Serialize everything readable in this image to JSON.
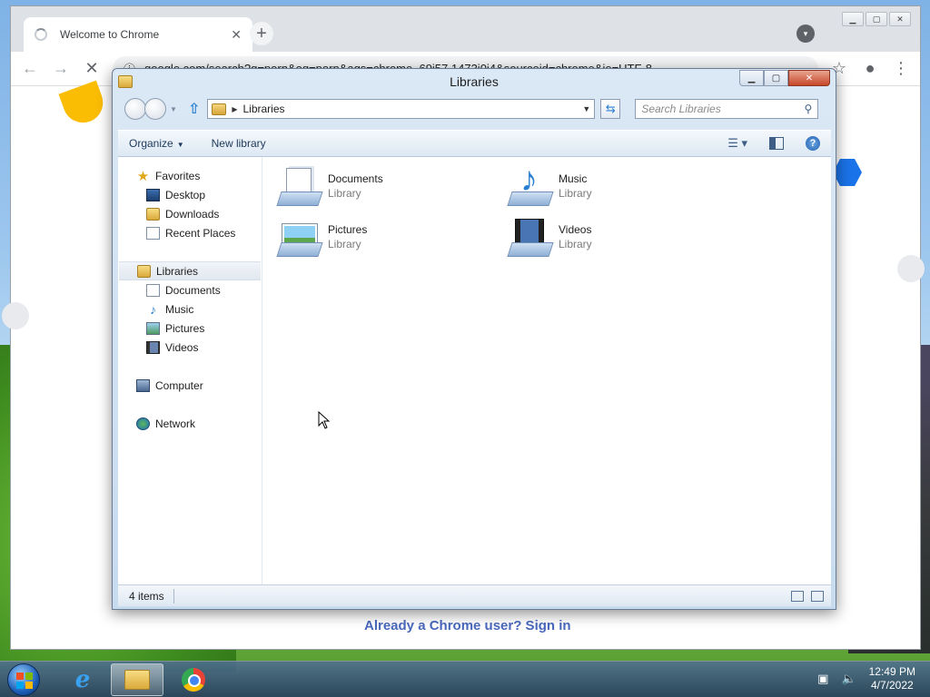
{
  "chrome": {
    "tab_title": "Welcome to Chrome",
    "tab_close": "✕",
    "new_tab": "+",
    "url": "google.com/search?q=porn&oq=porn&aqs=chrome..69i57.1473j0j4&sourceid=chrome&ie=UTF-8",
    "signin_text": "Already a Chrome user? Sign in"
  },
  "explorer": {
    "title": "Libraries",
    "address": "Libraries",
    "search_placeholder": "Search Libraries",
    "commands": {
      "organize": "Organize",
      "new_library": "New library"
    },
    "nav": {
      "favorites": {
        "label": "Favorites",
        "items": [
          "Desktop",
          "Downloads",
          "Recent Places"
        ]
      },
      "libraries": {
        "label": "Libraries",
        "items": [
          "Documents",
          "Music",
          "Pictures",
          "Videos"
        ]
      },
      "computer": "Computer",
      "network": "Network"
    },
    "tiles": [
      {
        "name": "Documents",
        "sub": "Library",
        "icon": "documents-library-icon"
      },
      {
        "name": "Music",
        "sub": "Library",
        "icon": "music-library-icon"
      },
      {
        "name": "Pictures",
        "sub": "Library",
        "icon": "pictures-library-icon"
      },
      {
        "name": "Videos",
        "sub": "Library",
        "icon": "videos-library-icon"
      }
    ],
    "status": "4 items"
  },
  "taskbar": {
    "time": "12:49 PM",
    "date": "4/7/2022"
  },
  "colors": {
    "accent": "#2a7fd0",
    "signin_link": "#4a69bd"
  }
}
